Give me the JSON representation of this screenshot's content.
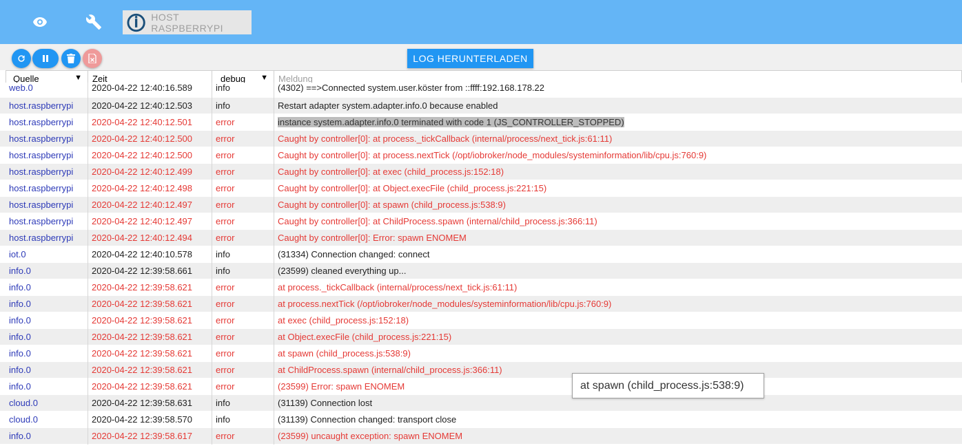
{
  "topbar": {
    "host_label": "HOST RASPBERRYPI",
    "icons": [
      "eye-icon",
      "wrench-icon"
    ]
  },
  "toolbar": {
    "download_label": "LOG HERUNTERLADEN",
    "buttons": [
      "refresh-icon",
      "pause-icon",
      "trash-icon",
      "delete-file-icon"
    ]
  },
  "table": {
    "headers": {
      "source": "Quelle",
      "time": "Zeit",
      "severity": "debug",
      "message": "Meldung"
    },
    "rows": [
      {
        "source": "web.0",
        "time": "2020-04-22 12:40:16.589",
        "severity": "info",
        "message": "(4302) ==>Connected system.user.köster from ::ffff:192.168.178.22"
      },
      {
        "source": "host.raspberrypi",
        "time": "2020-04-22 12:40:12.503",
        "severity": "info",
        "message": "Restart adapter system.adapter.info.0 because enabled"
      },
      {
        "source": "host.raspberrypi",
        "time": "2020-04-22 12:40:12.501",
        "severity": "error",
        "message": "instance system.adapter.info.0 terminated with code 1 (JS_CONTROLLER_STOPPED)"
      },
      {
        "source": "host.raspberrypi",
        "time": "2020-04-22 12:40:12.500",
        "severity": "error",
        "message": "Caught by controller[0]: at process._tickCallback (internal/process/next_tick.js:61:11)"
      },
      {
        "source": "host.raspberrypi",
        "time": "2020-04-22 12:40:12.500",
        "severity": "error",
        "message": "Caught by controller[0]: at process.nextTick (/opt/iobroker/node_modules/systeminformation/lib/cpu.js:760:9)"
      },
      {
        "source": "host.raspberrypi",
        "time": "2020-04-22 12:40:12.499",
        "severity": "error",
        "message": "Caught by controller[0]: at exec (child_process.js:152:18)"
      },
      {
        "source": "host.raspberrypi",
        "time": "2020-04-22 12:40:12.498",
        "severity": "error",
        "message": "Caught by controller[0]: at Object.execFile (child_process.js:221:15)"
      },
      {
        "source": "host.raspberrypi",
        "time": "2020-04-22 12:40:12.497",
        "severity": "error",
        "message": "Caught by controller[0]: at spawn (child_process.js:538:9)"
      },
      {
        "source": "host.raspberrypi",
        "time": "2020-04-22 12:40:12.497",
        "severity": "error",
        "message": "Caught by controller[0]: at ChildProcess.spawn (internal/child_process.js:366:11)"
      },
      {
        "source": "host.raspberrypi",
        "time": "2020-04-22 12:40:12.494",
        "severity": "error",
        "message": "Caught by controller[0]: Error: spawn ENOMEM"
      },
      {
        "source": "iot.0",
        "time": "2020-04-22 12:40:10.578",
        "severity": "info",
        "message": "(31334) Connection changed: connect"
      },
      {
        "source": "info.0",
        "time": "2020-04-22 12:39:58.661",
        "severity": "info",
        "message": "(23599) cleaned everything up..."
      },
      {
        "source": "info.0",
        "time": "2020-04-22 12:39:58.621",
        "severity": "error",
        "message": "at process._tickCallback (internal/process/next_tick.js:61:11)"
      },
      {
        "source": "info.0",
        "time": "2020-04-22 12:39:58.621",
        "severity": "error",
        "message": "at process.nextTick (/opt/iobroker/node_modules/systeminformation/lib/cpu.js:760:9)"
      },
      {
        "source": "info.0",
        "time": "2020-04-22 12:39:58.621",
        "severity": "error",
        "message": "at exec (child_process.js:152:18)"
      },
      {
        "source": "info.0",
        "time": "2020-04-22 12:39:58.621",
        "severity": "error",
        "message": "at Object.execFile (child_process.js:221:15)"
      },
      {
        "source": "info.0",
        "time": "2020-04-22 12:39:58.621",
        "severity": "error",
        "message": "at spawn (child_process.js:538:9)"
      },
      {
        "source": "info.0",
        "time": "2020-04-22 12:39:58.621",
        "severity": "error",
        "message": "at ChildProcess.spawn (internal/child_process.js:366:11)"
      },
      {
        "source": "info.0",
        "time": "2020-04-22 12:39:58.621",
        "severity": "error",
        "message": "(23599) Error: spawn ENOMEM"
      },
      {
        "source": "cloud.0",
        "time": "2020-04-22 12:39:58.631",
        "severity": "info",
        "message": "(31139) Connection lost"
      },
      {
        "source": "cloud.0",
        "time": "2020-04-22 12:39:58.570",
        "severity": "info",
        "message": "(31139) Connection changed: transport close"
      },
      {
        "source": "info.0",
        "time": "2020-04-22 12:39:58.617",
        "severity": "error",
        "message": "(23599) uncaught exception: spawn ENOMEM"
      }
    ],
    "highlighted_row": 2
  },
  "tooltip": {
    "text": "at spawn (child_process.js:538:9)"
  },
  "colors": {
    "topbar": "#64b5f6",
    "button_blue": "#2196f3",
    "button_disabled": "#ef9a9a",
    "error_text": "#e53935",
    "source_text": "#2d3ab8"
  }
}
